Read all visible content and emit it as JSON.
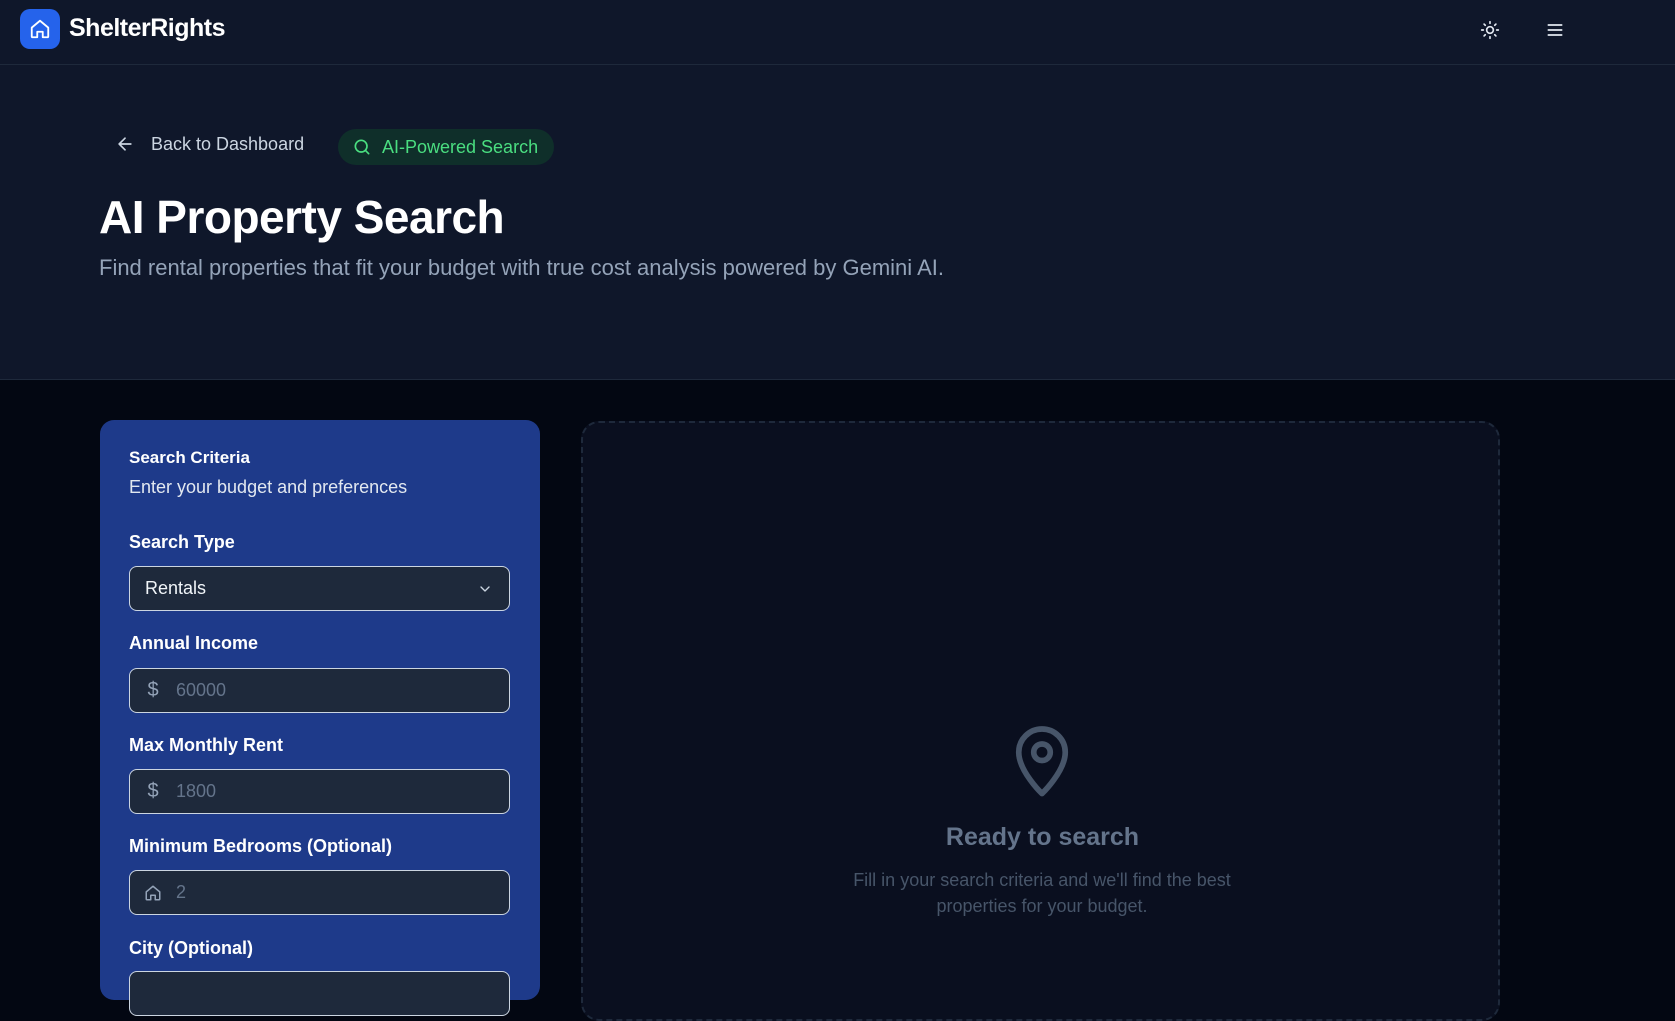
{
  "app": {
    "brand": "ShelterRights"
  },
  "nav": {
    "back_label": "Back to Dashboard",
    "badge_label": "AI-Powered Search"
  },
  "hero": {
    "title": "AI Property Search",
    "subtitle": "Find rental properties that fit your budget with true cost analysis powered by Gemini AI."
  },
  "form": {
    "title": "Search Criteria",
    "subtitle": "Enter your budget and preferences",
    "search_type": {
      "label": "Search Type",
      "value": "Rentals"
    },
    "annual_income": {
      "label": "Annual Income",
      "prefix": "$",
      "placeholder": "60000"
    },
    "max_rent": {
      "label": "Max Monthly Rent",
      "prefix": "$",
      "placeholder": "1800"
    },
    "bedrooms": {
      "label": "Minimum Bedrooms (Optional)",
      "placeholder": "2"
    },
    "city": {
      "label": "City (Optional)"
    }
  },
  "results": {
    "empty_title": "Ready to search",
    "empty_text": "Fill in your search criteria and we'll find the best properties for your budget."
  },
  "icons": {
    "logo": "home-icon",
    "theme": "sun-icon",
    "menu": "menu-icon",
    "back": "arrow-left-icon",
    "badge": "search-icon",
    "empty": "map-pin-icon"
  },
  "colors": {
    "accent": "#2563eb",
    "panel": "#1e3a8a",
    "badge_text": "#4ade80",
    "background": "#030712"
  }
}
